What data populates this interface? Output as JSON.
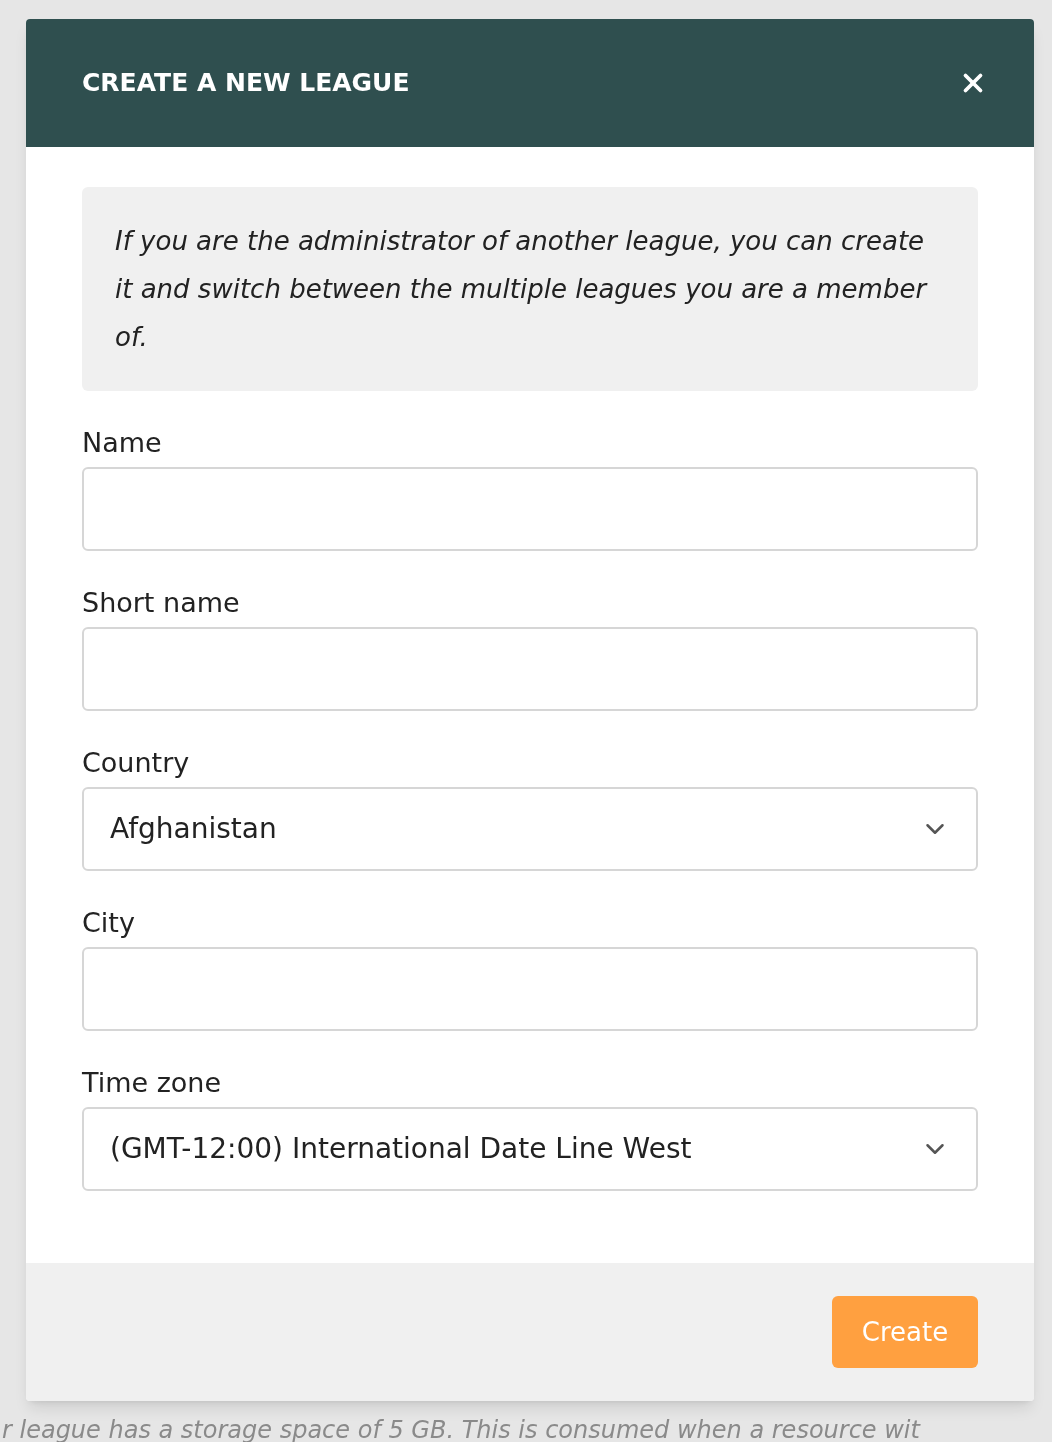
{
  "dialog": {
    "title": "CREATE A NEW LEAGUE",
    "note": "If you are the administrator of another league, you can create it and switch between the multiple leagues you are a member of.",
    "fields": [
      {
        "kind": "text",
        "label": "Name"
      },
      {
        "kind": "text",
        "label": "Short name"
      },
      {
        "kind": "select",
        "label": "Country",
        "value": "Afghanistan"
      },
      {
        "kind": "text",
        "label": "City"
      },
      {
        "kind": "select",
        "label": "Time zone",
        "value": "(GMT-12:00) International Date Line West"
      }
    ],
    "submit": "Create"
  },
  "background": {
    "text": "r league has a storage space of 5 GB. This is consumed when a resource wit"
  }
}
